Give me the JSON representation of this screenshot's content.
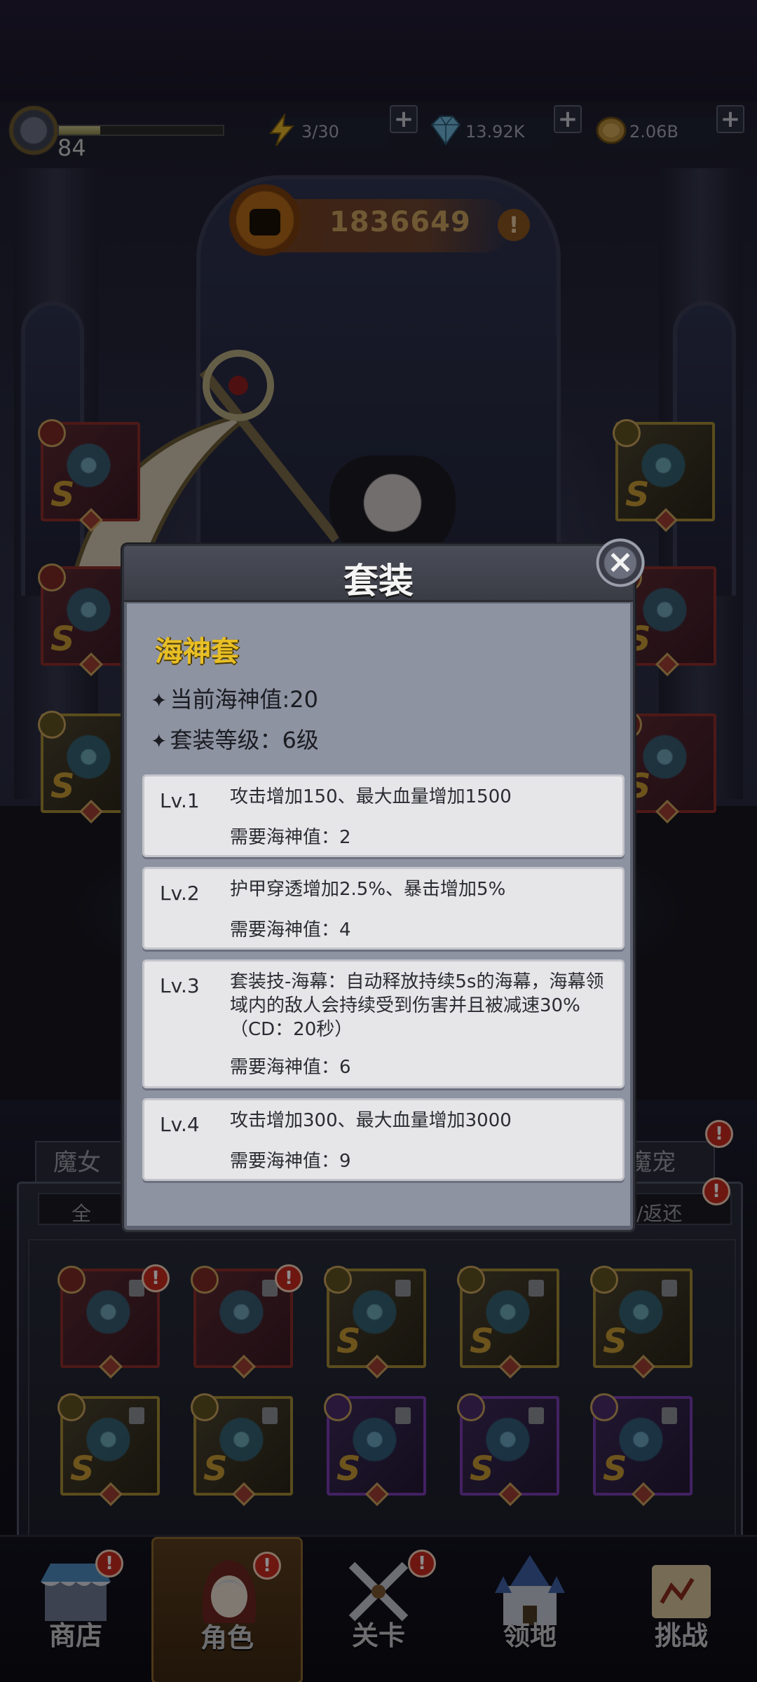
{
  "top_bar": {
    "level": "84",
    "xp_fraction": 0.25,
    "energy": "3/30",
    "diamonds": "13.92K",
    "gold": "2.06B",
    "plus_symbol": "+"
  },
  "power": {
    "value": "1836649",
    "info_symbol": "!"
  },
  "modal": {
    "title": "套装",
    "close_symbol": "×",
    "set_name": "海神套",
    "current_value_line": "当前海神值:20",
    "set_level_line": "套装等级：6级",
    "star_glyph": "✦",
    "levels": [
      {
        "tag": "Lv.1",
        "desc": "攻击增加150、最大血量增加1500",
        "req": "需要海神值：2"
      },
      {
        "tag": "Lv.2",
        "desc": "护甲穿透增加2.5%、暴击增加5%",
        "req": "需要海神值：4"
      },
      {
        "tag": "Lv.3",
        "desc": "套装技-海幕：自动释放持续5s的海幕，海幕领域内的敌人会持续受到伤害并且被减速30%（CD：20秒）",
        "req": "需要海神值：6"
      },
      {
        "tag": "Lv.4",
        "desc": "攻击增加300、最大血量增加3000",
        "req": "需要海神值：9"
      }
    ]
  },
  "lower_panel": {
    "tab_left": "魔女",
    "tab_right": "魔宠",
    "filter_left": "全",
    "filter_right": "/返还",
    "grade_letter": "S",
    "alert_symbol": "!"
  },
  "bottom_nav": [
    {
      "label": "商店",
      "icon": "shop-icon"
    },
    {
      "label": "角色",
      "icon": "character-icon"
    },
    {
      "label": "关卡",
      "icon": "stage-icon"
    },
    {
      "label": "领地",
      "icon": "territory-icon"
    },
    {
      "label": "挑战",
      "icon": "challenge-icon"
    }
  ]
}
